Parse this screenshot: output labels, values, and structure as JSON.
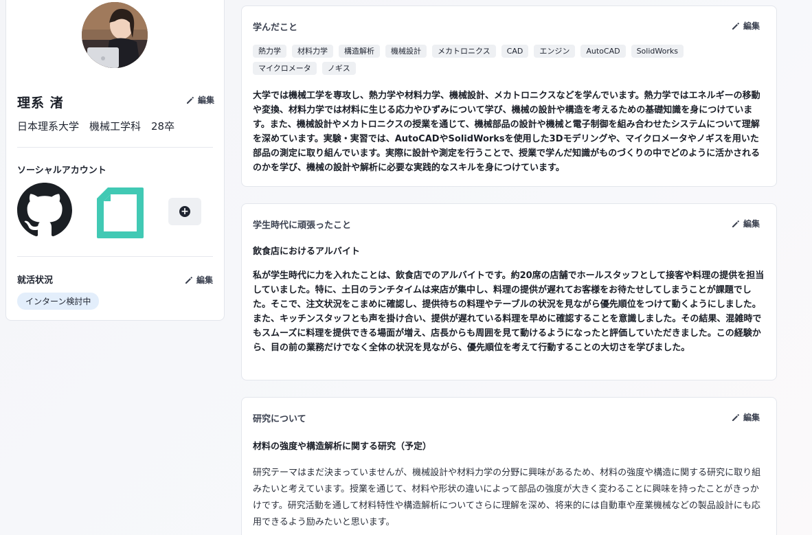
{
  "profile": {
    "name": "理系 渚",
    "school": "日本理系大学　機械工学科　28卒",
    "edit_label": "編集",
    "social_label": "ソーシャルアカウント",
    "job_status_label": "就活状況",
    "job_status_badge": "インターン検討中"
  },
  "icons": [
    "pencil-icon",
    "github-icon",
    "note-icon",
    "plus-circle-icon"
  ],
  "learned": {
    "title": "学んだこと",
    "edit_label": "編集",
    "tags": [
      "熱力学",
      "材料力学",
      "構造解析",
      "機械設計",
      "メカトロニクス",
      "CAD",
      "エンジン",
      "AutoCAD",
      "SolidWorks",
      "マイクロメータ",
      "ノギス"
    ],
    "text": "大学では機械工学を専攻し、熱力学や材料力学、機械設計、メカトロニクスなどを学んでいます。熱力学ではエネルギーの移動や変換、材料力学では材料に生じる応力やひずみについて学び、機械の設計や構造を考えるための基礎知識を身につけています。また、機械設計やメカトロニクスの授業を通じて、機械部品の設計や機械と電子制御を組み合わせたシステムについて理解を深めています。実験・実習では、AutoCADやSolidWorksを使用した3Dモデリングや、マイクロメータやノギスを用いた部品の測定に取り組んでいます。実際に設計や測定を行うことで、授業で学んだ知識がものづくりの中でどのように活かされるのかを学び、機械の設計や解析に必要な実践的なスキルを身につけています。"
  },
  "effort": {
    "title": "学生時代に頑張ったこと",
    "edit_label": "編集",
    "subtitle": "飲食店におけるアルバイト",
    "text": "私が学生時代に力を入れたことは、飲食店でのアルバイトです。約20席の店舗でホールスタッフとして接客や料理の提供を担当していました。特に、土日のランチタイムは来店が集中し、料理の提供が遅れてお客様をお待たせしてしまうことが課題でした。そこで、注文状況をこまめに確認し、提供待ちの料理やテーブルの状況を見ながら優先順位をつけて動くようにしました。また、キッチンスタッフとも声を掛け合い、提供が遅れている料理を早めに確認することを意識しました。その結果、混雑時でもスムーズに料理を提供できる場面が増え、店長からも周囲を見て動けるようになったと評価していただきました。この経験から、目の前の業務だけでなく全体の状況を見ながら、優先順位を考えて行動することの大切さを学びました。"
  },
  "research": {
    "title": "研究について",
    "edit_label": "編集",
    "subtitle": "材料の強度や構造解析に関する研究（予定）",
    "text": "研究テーマはまだ決まっていませんが、機械設計や材料力学の分野に興味があるため、材料の強度や構造に関する研究に取り組みたいと考えています。授業を通じて、材料や形状の違いによって部品の強度が大きく変わることに興味を持ったことがきっかけです。研究活動を通して材料特性や構造解析についてさらに理解を深め、将来的には自動車や産業機械などの製品設計にも応用できるよう励みたいと思います。"
  },
  "colors": {
    "accent_note": "#41c9b4",
    "badge_bg": "#e3eefb",
    "tag_bg": "#eef0f3"
  }
}
